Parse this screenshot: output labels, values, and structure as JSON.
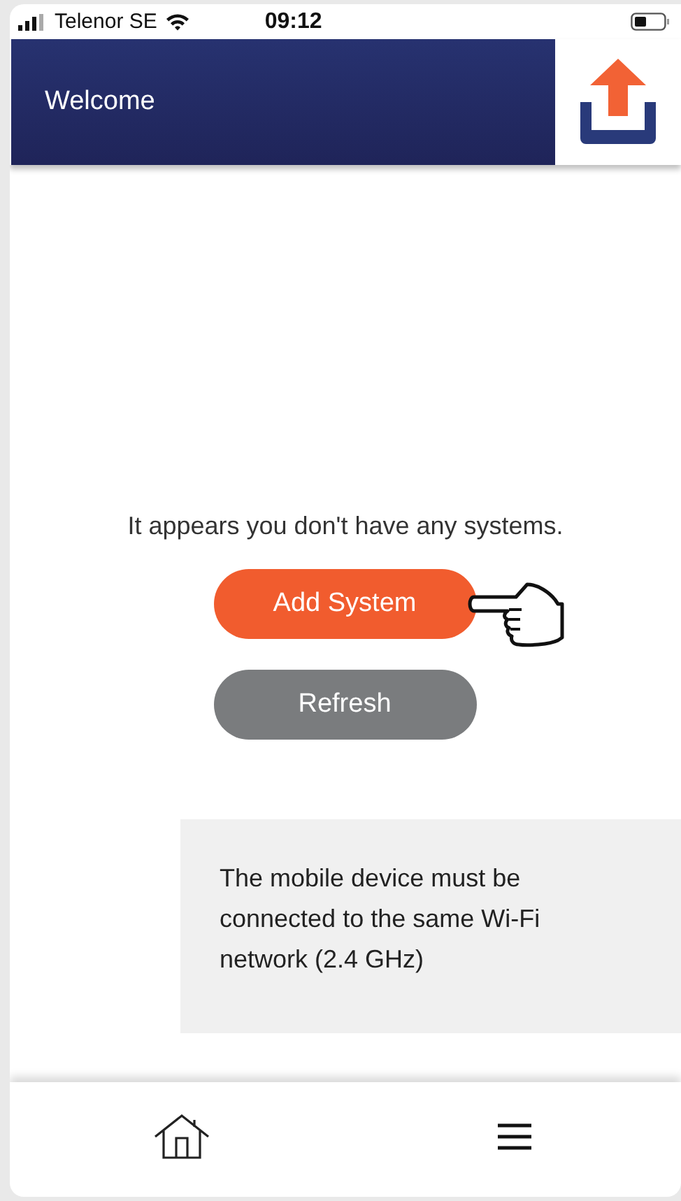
{
  "status_bar": {
    "carrier": "Telenor SE",
    "time": "09:12"
  },
  "header": {
    "title": "Welcome"
  },
  "message": "It appears you don't have any systems.",
  "buttons": [
    {
      "label": "Add System",
      "kind": "primary"
    },
    {
      "label": "Refresh",
      "kind": "secondary"
    }
  ],
  "info": "The mobile device must be connected to the same Wi-Fi network (2.4 GHz)"
}
